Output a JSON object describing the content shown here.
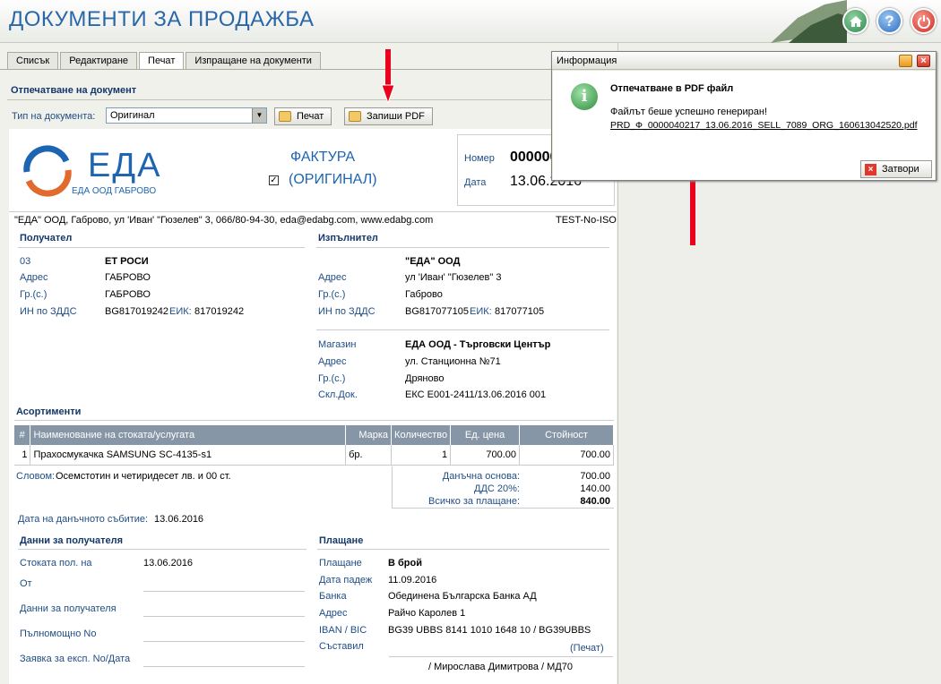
{
  "app": {
    "title": "ДОКУМЕНТИ ЗА ПРОДАЖБА"
  },
  "tabs": [
    {
      "label": "Списък"
    },
    {
      "label": "Редактиране"
    },
    {
      "label": "Печат"
    },
    {
      "label": "Изпращане на документи"
    }
  ],
  "print_panel": {
    "title": "Отпечатване на документ",
    "doc_type_label": "Тип на документа:",
    "doc_type_value": "Оригинал",
    "print_button": "Печат",
    "save_pdf_button": "Запиши PDF"
  },
  "invoice": {
    "logo_text": "ЕДА",
    "logo_sub": "ЕДА ООД ГАБРОВО",
    "doc_title": "ФАКТУРА",
    "doc_subtitle": "(ОРИГИНАЛ)",
    "number_label": "Номер",
    "number_value": "000000",
    "date_label": "Дата",
    "date_value": "13.06.2016",
    "company_line": "\"ЕДА\" ООД, Габрово, ул 'Иван' \"Гюзелев\" 3, 066/80-94-30, eda@edabg.com, www.edabg.com",
    "iso_tag": "TEST-No-ISO",
    "recipient": {
      "title": "Получател",
      "code_label": "03",
      "name": "ЕТ РОСИ",
      "address_label": "Адрес",
      "address": "ГАБРОВО",
      "city_label": "Гр.(с.)",
      "city": "ГАБРОВО",
      "vat_label": "ИН по ЗДДС",
      "vat": "BG817019242",
      "eik_label": "ЕИК:",
      "eik": "817019242"
    },
    "supplier": {
      "title": "Изпълнител",
      "name": "\"ЕДА\" ООД",
      "address_label": "Адрес",
      "address": "ул 'Иван' \"Гюзелев\" 3",
      "city_label": "Гр.(с.)",
      "city": "Габрово",
      "vat_label": "ИН по ЗДДС",
      "vat": "BG817077105",
      "eik_label": "ЕИК:",
      "eik": "817077105",
      "shop_label": "Магазин",
      "shop": "ЕДА ООД - Търговски Център",
      "shop_address_label": "Адрес",
      "shop_address": "ул. Станционна №71",
      "shop_city_label": "Гр.(с.)",
      "shop_city": "Дряново",
      "warehouse_doc_label": "Скл.Док.",
      "warehouse_doc": "ЕКС Е001-2411/13.06.2016 001"
    },
    "items_title": "Асортименти",
    "items_headers": [
      "#",
      "Наименование на стоката/услугата",
      "Марка",
      "Количество",
      "Ед. цена",
      "Стойност"
    ],
    "items": [
      {
        "num": "1",
        "name": "Прахосмукачка SAMSUNG SC-4135-s1",
        "unit": "бр.",
        "qty": "1",
        "price": "700.00",
        "amount": "700.00"
      }
    ],
    "words_label": "Словом:",
    "words": "Осемстотин и четиридесет лв. и 00 ст.",
    "tax_base_label": "Данъчна основа:",
    "tax_base": "700.00",
    "vat_rate_label": "ДДС 20%:",
    "vat_amount": "140.00",
    "total_label": "Всичко за плащане:",
    "total": "840.00",
    "tax_event_label": "Дата на данъчното събитие:",
    "tax_event_date": "13.06.2016",
    "recipient_data": {
      "title": "Данни за получателя",
      "received_label": "Стоката пол. на",
      "received_date": "13.06.2016",
      "from_label": "От",
      "recipient_data_label": "Данни за получателя",
      "power_of_attorney_label": "Пълномощно No",
      "order_label": "Заявка за експ. No/Дата"
    },
    "payment": {
      "title": "Плащане",
      "payment_label": "Плащане",
      "payment_method": "В брой",
      "due_label": "Дата падеж",
      "due_date": "11.09.2016",
      "bank_label": "Банка",
      "bank": "Обединена Българска Банка АД",
      "address_label": "Адрес",
      "address": "Райчо Каролев 1",
      "iban_label": "IBAN / BIC",
      "iban": "BG39 UBBS 8141 1010 1648 10 / BG39UBBS",
      "compiled_label": "Съставил",
      "print_link": "(Печат)",
      "compiler": "/ Мирослава Димитрова / МД70"
    }
  },
  "dialog": {
    "title": "Информация",
    "heading": "Отпечатване в PDF файл",
    "message": "Файлът беше успешно генериран!",
    "filename": "PRD_Ф_0000040217_13.06.2016_SELL_7089_ORG_160613042520.pdf",
    "close_button": "Затвори"
  },
  "colors": {
    "accent": "#2a67a8",
    "table_header": "#8796a6",
    "label_blue": "#1e4d86",
    "annotation_arrow": "#e8001c"
  }
}
